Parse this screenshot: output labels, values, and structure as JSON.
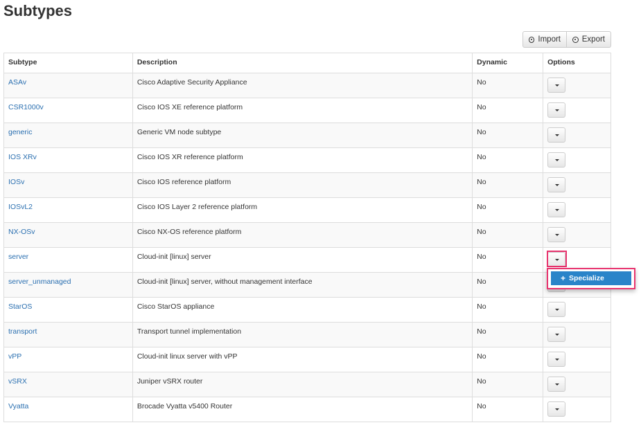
{
  "page": {
    "title": "Subtypes"
  },
  "toolbar": {
    "import_label": "Import",
    "export_label": "Export"
  },
  "table": {
    "headers": {
      "subtype": "Subtype",
      "description": "Description",
      "dynamic": "Dynamic",
      "options": "Options"
    },
    "rows": [
      {
        "subtype": "ASAv",
        "description": "Cisco Adaptive Security Appliance",
        "dynamic": "No"
      },
      {
        "subtype": "CSR1000v",
        "description": "Cisco IOS XE reference platform",
        "dynamic": "No"
      },
      {
        "subtype": "generic",
        "description": "Generic VM node subtype",
        "dynamic": "No"
      },
      {
        "subtype": "IOS XRv",
        "description": "Cisco IOS XR reference platform",
        "dynamic": "No"
      },
      {
        "subtype": "IOSv",
        "description": "Cisco IOS reference platform",
        "dynamic": "No"
      },
      {
        "subtype": "IOSvL2",
        "description": "Cisco IOS Layer 2 reference platform",
        "dynamic": "No"
      },
      {
        "subtype": "NX-OSv",
        "description": "Cisco NX-OS reference platform",
        "dynamic": "No"
      },
      {
        "subtype": "server",
        "description": "Cloud-init [linux] server",
        "dynamic": "No"
      },
      {
        "subtype": "server_unmanaged",
        "description": "Cloud-init [linux] server, without management interface",
        "dynamic": "No"
      },
      {
        "subtype": "StarOS",
        "description": "Cisco StarOS appliance",
        "dynamic": "No"
      },
      {
        "subtype": "transport",
        "description": "Transport tunnel implementation",
        "dynamic": "No"
      },
      {
        "subtype": "vPP",
        "description": "Cloud-init linux server with vPP",
        "dynamic": "No"
      },
      {
        "subtype": "vSRX",
        "description": "Juniper vSRX router",
        "dynamic": "No"
      },
      {
        "subtype": "Vyatta",
        "description": "Brocade Vyatta v5400 Router",
        "dynamic": "No"
      }
    ]
  },
  "dropdown": {
    "open_row": "server",
    "items": [
      {
        "label": "Specialize",
        "icon": "plus-icon"
      }
    ]
  },
  "colors": {
    "link": "#2a6fb0",
    "highlight": "#e8336e",
    "menu_active": "#2a84c9"
  }
}
